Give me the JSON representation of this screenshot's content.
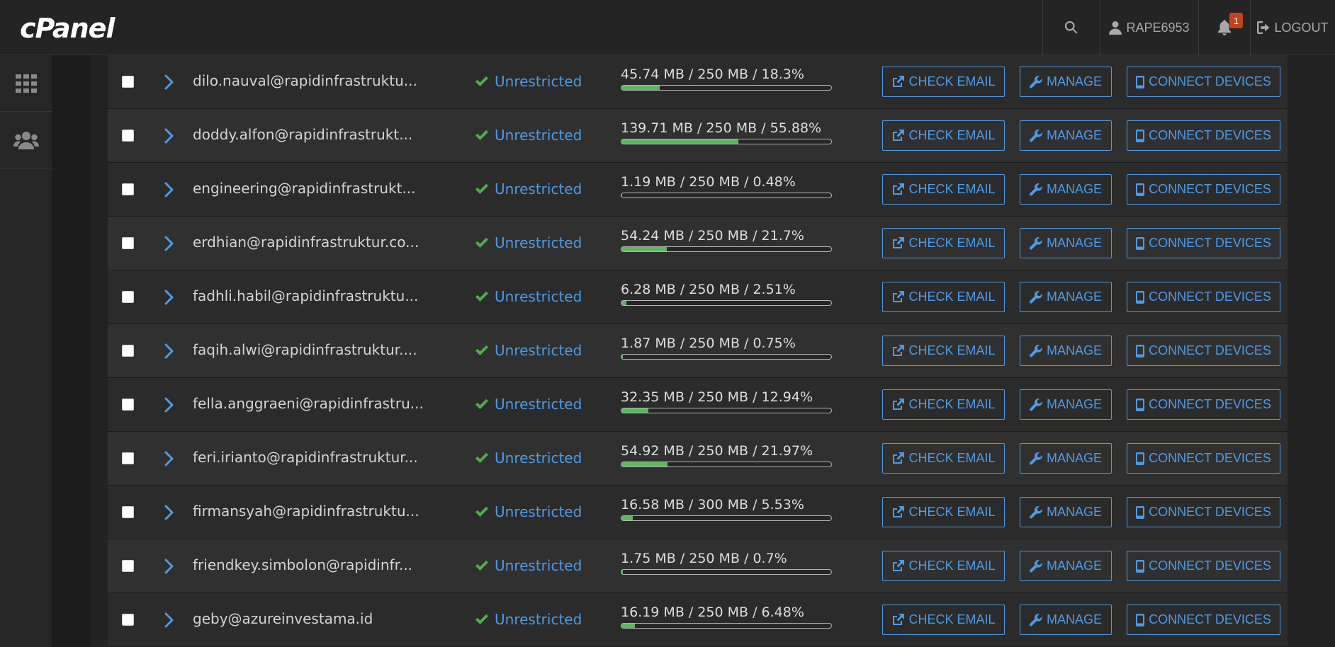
{
  "header": {
    "logo": "cPanel",
    "username": "RAPE6953",
    "notification_count": "1",
    "logout_label": "LOGOUT"
  },
  "buttons": {
    "check_email": "CHECK EMAIL",
    "manage": "MANAGE",
    "connect_devices": "CONNECT DEVICES"
  },
  "accounts": [
    {
      "email": "dilo.nauval@rapidinfrastruktu...",
      "status": "Unrestricted",
      "usage": "45.74 MB / 250 MB / 18.3%",
      "percent": 18.3
    },
    {
      "email": "doddy.alfon@rapidinfrastrukt...",
      "status": "Unrestricted",
      "usage": "139.71 MB / 250 MB / 55.88%",
      "percent": 55.88
    },
    {
      "email": "engineering@rapidinfrastrukt...",
      "status": "Unrestricted",
      "usage": "1.19 MB / 250 MB / 0.48%",
      "percent": 0.48
    },
    {
      "email": "erdhian@rapidinfrastruktur.co...",
      "status": "Unrestricted",
      "usage": "54.24 MB / 250 MB / 21.7%",
      "percent": 21.7
    },
    {
      "email": "fadhli.habil@rapidinfrastruktu...",
      "status": "Unrestricted",
      "usage": "6.28 MB / 250 MB / 2.51%",
      "percent": 2.51
    },
    {
      "email": "faqih.alwi@rapidinfrastruktur....",
      "status": "Unrestricted",
      "usage": "1.87 MB / 250 MB / 0.75%",
      "percent": 0.75
    },
    {
      "email": "fella.anggraeni@rapidinfrastru...",
      "status": "Unrestricted",
      "usage": "32.35 MB / 250 MB / 12.94%",
      "percent": 12.94
    },
    {
      "email": "feri.irianto@rapidinfrastruktur...",
      "status": "Unrestricted",
      "usage": "54.92 MB / 250 MB / 21.97%",
      "percent": 21.97
    },
    {
      "email": "firmansyah@rapidinfrastruktu...",
      "status": "Unrestricted",
      "usage": "16.58 MB / 300 MB / 5.53%",
      "percent": 5.53
    },
    {
      "email": "friendkey.simbolon@rapidinfr...",
      "status": "Unrestricted",
      "usage": "1.75 MB / 250 MB / 0.7%",
      "percent": 0.7
    },
    {
      "email": "geby@azureinvestama.id",
      "status": "Unrestricted",
      "usage": "16.19 MB / 250 MB / 6.48%",
      "percent": 6.48
    }
  ]
}
